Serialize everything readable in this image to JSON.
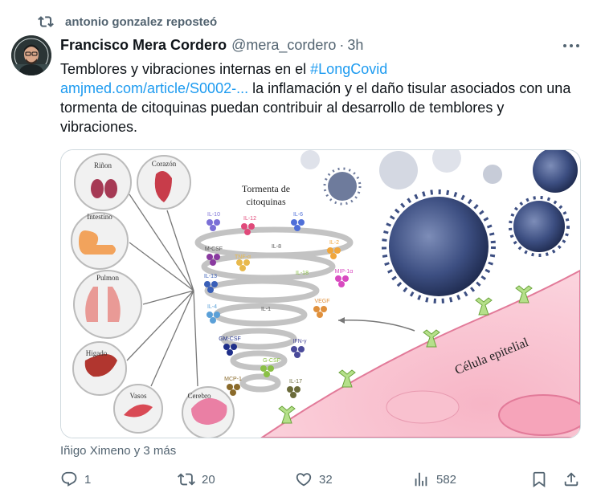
{
  "retweet": {
    "text": "antonio gonzalez reposteó",
    "icon": "retweet-icon"
  },
  "tweet": {
    "author_name": "Francisco Mera Cordero",
    "handle": "@mera_cordero",
    "separator": "·",
    "time": "3h",
    "text_line1": "Temblores y vibraciones internas en el ",
    "hashtag": "#LongCovid",
    "link": "amjmed.com/article/S0002-...",
    "text_rest": " la inflamación y el daño tisular asociados con una tormenta de citoquinas puedan contribuir al desarrollo de temblores y vibraciones."
  },
  "image": {
    "organs": [
      "Riñon",
      "Corazón",
      "Intestino",
      "Pulmon",
      "Higado",
      "Vasos",
      "Cerebro"
    ],
    "storm_title_1": "Tormenta de",
    "storm_title_2": "citoquinas",
    "cytokines": [
      "IL-10",
      "IL-12",
      "IL-6",
      "IL-2",
      "M-CSF",
      "IL-8",
      "TNF-α",
      "MIP-1α",
      "IL-13",
      "IL-18",
      "VEGF",
      "IL-4",
      "IL-1",
      "IFN-γ",
      "GM-CSF",
      "G-CSF",
      "MCP-1",
      "IL-17"
    ],
    "cell_label": "Célula epitelial"
  },
  "likers": "Iñigo Ximeno y 3 más",
  "actions": {
    "replies": "1",
    "reposts": "20",
    "likes": "32",
    "views": "582"
  },
  "colors": {
    "link": "#1d9bf0",
    "muted": "#536471",
    "text": "#0f1419"
  }
}
